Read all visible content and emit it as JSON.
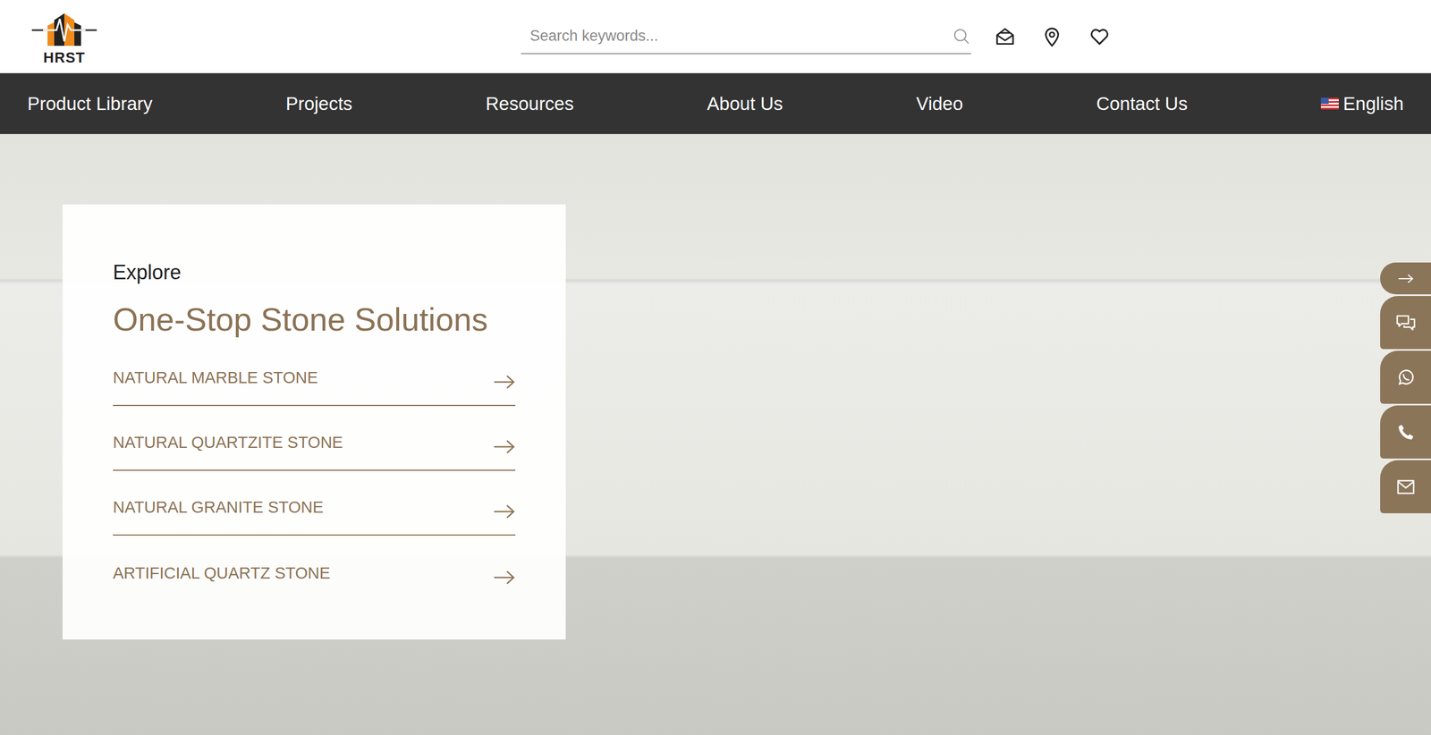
{
  "header": {
    "logo": "HRST",
    "search": {
      "placeholder": "Search keywords..."
    }
  },
  "nav": {
    "items": [
      {
        "label": "Product Library"
      },
      {
        "label": "Projects"
      },
      {
        "label": "Resources"
      },
      {
        "label": "About Us"
      },
      {
        "label": "Video"
      },
      {
        "label": "Contact Us"
      }
    ],
    "language": "English"
  },
  "hero": {
    "eyebrow": "Explore",
    "title": "One-Stop Stone Solutions",
    "items": [
      {
        "label": "NATURAL MARBLE STONE"
      },
      {
        "label": "NATURAL QUARTZITE STONE"
      },
      {
        "label": "NATURAL GRANITE STONE"
      },
      {
        "label": "ARTIFICIAL QUARTZ STONE"
      }
    ]
  }
}
